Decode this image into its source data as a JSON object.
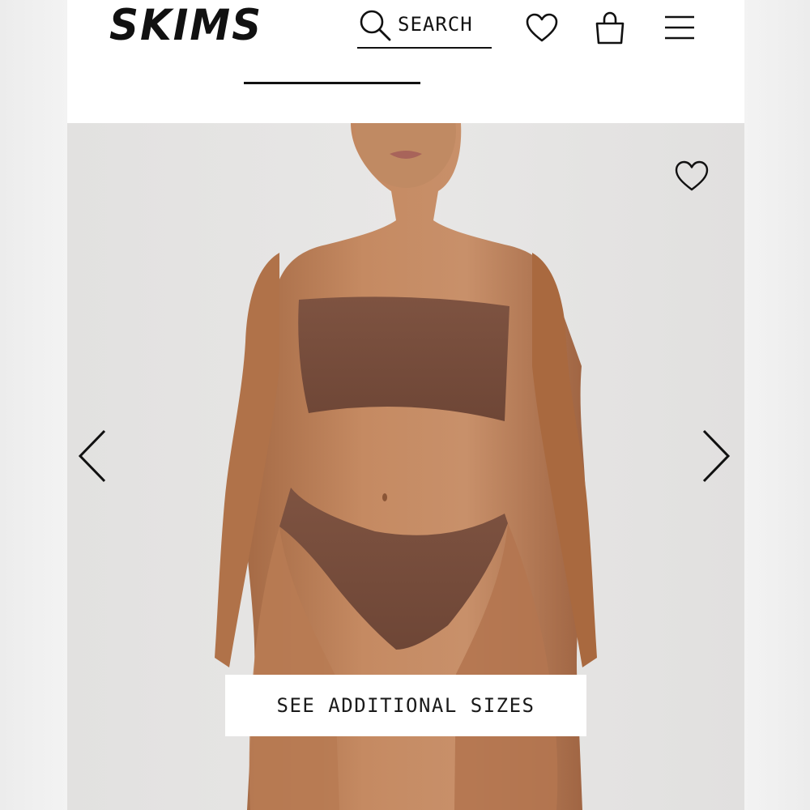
{
  "header": {
    "logo": "SKIMS",
    "search_label": "SEARCH",
    "icons": [
      "search-icon",
      "heart-icon",
      "shopping-bag-icon",
      "menu-icon"
    ]
  },
  "product": {
    "wishlist_icon": "heart-icon",
    "prev_icon": "chevron-left-icon",
    "next_icon": "chevron-right-icon",
    "sizes_button_label": "SEE ADDITIONAL SIZES"
  },
  "colors": {
    "text": "#111111",
    "background": "#ffffff",
    "hero_background": "#e4e3e2",
    "garment": "#7a4f3d",
    "skin": "#b97d56"
  }
}
